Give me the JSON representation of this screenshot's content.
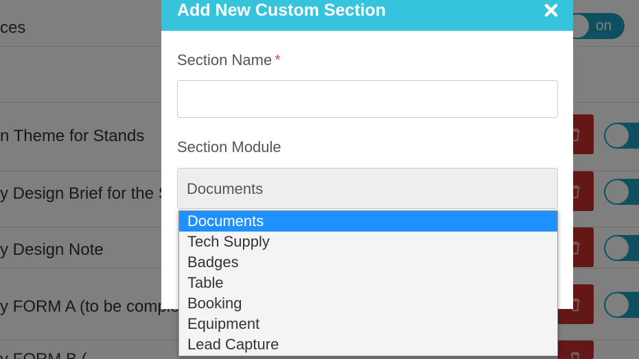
{
  "background": {
    "rows": [
      {
        "text": "ces"
      },
      {
        "text": ""
      },
      {
        "text": "n Theme for Stands"
      },
      {
        "text": "y Design Brief for the S"
      },
      {
        "text": "y Design Note"
      },
      {
        "text": "y FORM A (to be comple"
      },
      {
        "text": "y FORM B (..."
      }
    ],
    "toggle_label": "on"
  },
  "modal": {
    "title": "Add New Custom Section",
    "close_icon": "close-icon",
    "section_name": {
      "label": "Section Name",
      "required_mark": "*",
      "value": "",
      "placeholder": ""
    },
    "section_module": {
      "label": "Section Module",
      "selected": "Documents",
      "options": [
        {
          "label": "Documents",
          "selected": true
        },
        {
          "label": "Tech Supply",
          "selected": false
        },
        {
          "label": "Badges",
          "selected": false
        },
        {
          "label": "Table",
          "selected": false
        },
        {
          "label": "Booking",
          "selected": false
        },
        {
          "label": "Equipment",
          "selected": false
        },
        {
          "label": "Lead Capture",
          "selected": false
        }
      ]
    }
  },
  "colors": {
    "header": "#36c3dc",
    "highlight": "#1e90ff",
    "delete_button": "#c9302c",
    "toggle": "#1ea0c0",
    "required": "#d9534f"
  }
}
